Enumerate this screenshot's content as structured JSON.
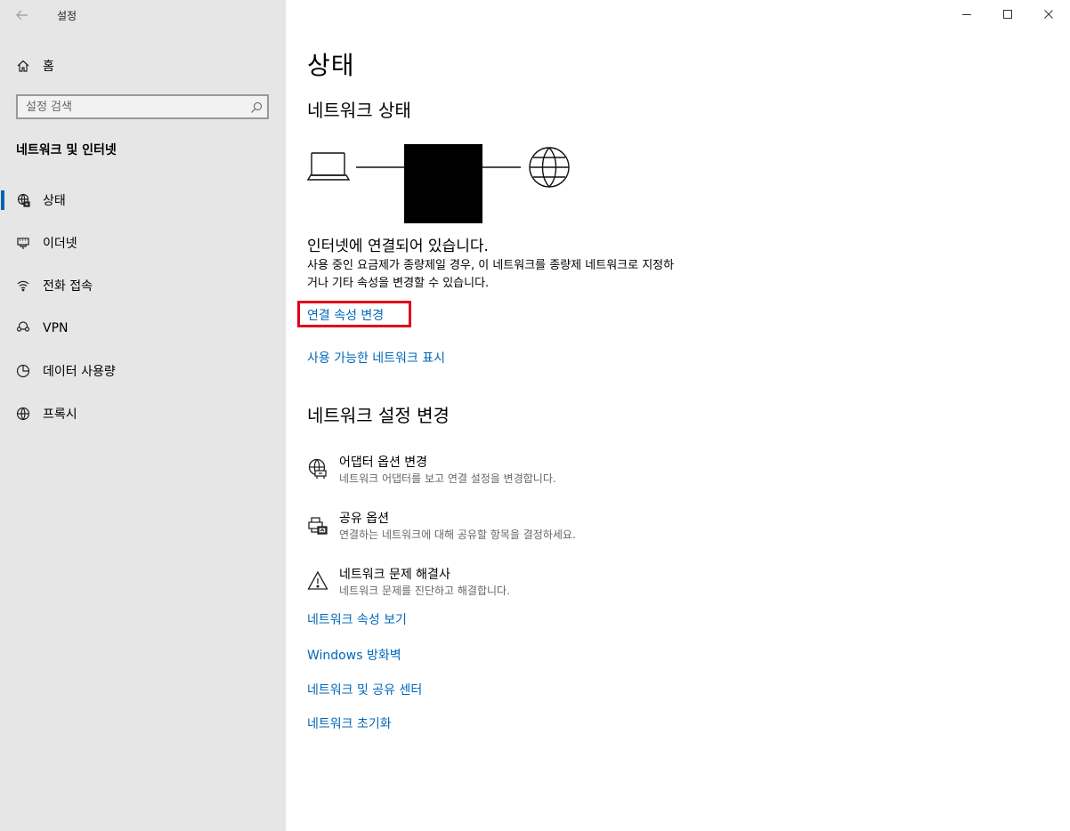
{
  "titlebar": {
    "back_icon": "back-arrow-icon",
    "app_title": "설정",
    "controls": [
      "minimize-icon",
      "maximize-icon",
      "close-icon"
    ]
  },
  "sidebar": {
    "home_label": "홈",
    "search_placeholder": "설정 검색",
    "section_label": "네트워크 및 인터넷",
    "items": [
      {
        "label": "상태",
        "icon": "status-globe-icon",
        "active": true
      },
      {
        "label": "이더넷",
        "icon": "ethernet-icon"
      },
      {
        "label": "전화 접속",
        "icon": "dialup-icon"
      },
      {
        "label": "VPN",
        "icon": "vpn-icon"
      },
      {
        "label": "데이터 사용량",
        "icon": "data-usage-icon"
      },
      {
        "label": "프록시",
        "icon": "proxy-globe-icon"
      }
    ]
  },
  "main": {
    "page_title": "상태",
    "network_status_heading": "네트워크 상태",
    "connection_status": "인터넷에 연결되어 있습니다.",
    "description": "사용 중인 요금제가 종량제일 경우, 이 네트워크를 종량제 네트워크로 지정하거나 기타 속성을 변경할 수 있습니다.",
    "link_change_properties": "연결 속성 변경",
    "link_show_networks": "사용 가능한 네트워크 표시",
    "change_settings_heading": "네트워크 설정 변경",
    "options": [
      {
        "title": "어댑터 옵션 변경",
        "subtitle": "네트워크 어댑터를 보고 연결 설정을 변경합니다.",
        "icon": "adapter-icon"
      },
      {
        "title": "공유 옵션",
        "subtitle": "연결하는 네트워크에 대해 공유할 항목을 결정하세요.",
        "icon": "sharing-icon"
      },
      {
        "title": "네트워크 문제 해결사",
        "subtitle": "네트워크 문제를 진단하고 해결합니다.",
        "icon": "warning-icon"
      }
    ],
    "bottom_links": [
      "네트워크 속성 보기",
      "Windows 방화벽",
      "네트워크 및 공유 센터",
      "네트워크 초기화"
    ]
  },
  "colors": {
    "link": "#0067b8",
    "accent": "#0063b1",
    "highlight": "#e0001b",
    "sidebar_bg": "#e6e6e6"
  }
}
